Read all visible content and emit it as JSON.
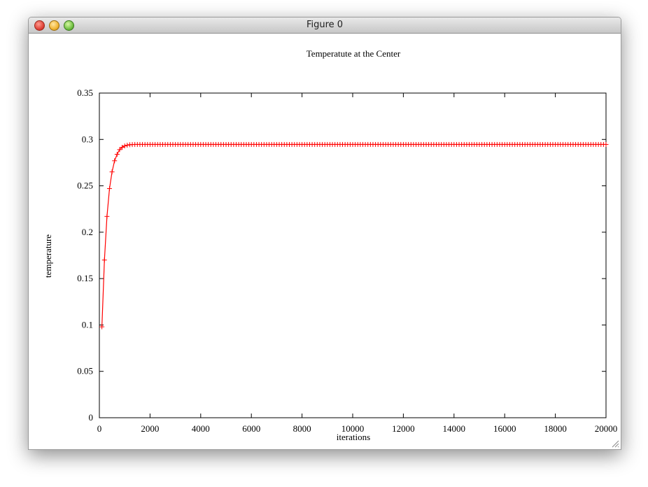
{
  "window": {
    "title": "Figure 0",
    "controls": [
      "close-button",
      "minimize-button",
      "zoom-button"
    ]
  },
  "chart_data": {
    "type": "line",
    "title": "Temperatute at the Center",
    "xlabel": "iterations",
    "ylabel": "temperature",
    "xlim": [
      0,
      20000
    ],
    "ylim": [
      0,
      0.35
    ],
    "x_ticks": [
      0,
      2000,
      4000,
      6000,
      8000,
      10000,
      12000,
      14000,
      16000,
      18000,
      20000
    ],
    "x_tick_labels": [
      "0",
      "2000",
      "4000",
      "6000",
      "8000",
      "10000",
      "12000",
      "14000",
      "16000",
      "18000",
      "20000"
    ],
    "y_ticks": [
      0,
      0.05,
      0.1,
      0.15,
      0.2,
      0.25,
      0.3,
      0.35
    ],
    "y_tick_labels": [
      "0",
      "0.05",
      "0.1",
      "0.15",
      "0.2",
      "0.25",
      "0.3",
      "0.35"
    ],
    "grid": false,
    "series": [
      {
        "color": "#ff0000",
        "marker": "+",
        "x": [
          100,
          200,
          300,
          400,
          500,
          600,
          700,
          800,
          900,
          1000,
          1100,
          1200,
          1300,
          1400,
          1500,
          1600,
          1700,
          1800,
          1900,
          2000,
          2100,
          2200,
          2300,
          2400,
          2500,
          2600,
          2700,
          2800,
          2900,
          3000,
          3100,
          3200,
          3300,
          3400,
          3500,
          3600,
          3700,
          3800,
          3900,
          4000,
          4100,
          4200,
          4300,
          4400,
          4500,
          4600,
          4700,
          4800,
          4900,
          5000,
          5100,
          5200,
          5300,
          5400,
          5500,
          5600,
          5700,
          5800,
          5900,
          6000,
          6100,
          6200,
          6300,
          6400,
          6500,
          6600,
          6700,
          6800,
          6900,
          7000,
          7100,
          7200,
          7300,
          7400,
          7500,
          7600,
          7700,
          7800,
          7900,
          8000,
          8100,
          8200,
          8300,
          8400,
          8500,
          8600,
          8700,
          8800,
          8900,
          9000,
          9100,
          9200,
          9300,
          9400,
          9500,
          9600,
          9700,
          9800,
          9900,
          10000,
          10100,
          10200,
          10300,
          10400,
          10500,
          10600,
          10700,
          10800,
          10900,
          11000,
          11100,
          11200,
          11300,
          11400,
          11500,
          11600,
          11700,
          11800,
          11900,
          12000,
          12100,
          12200,
          12300,
          12400,
          12500,
          12600,
          12700,
          12800,
          12900,
          13000,
          13100,
          13200,
          13300,
          13400,
          13500,
          13600,
          13700,
          13800,
          13900,
          14000,
          14100,
          14200,
          14300,
          14400,
          14500,
          14600,
          14700,
          14800,
          14900,
          15000,
          15100,
          15200,
          15300,
          15400,
          15500,
          15600,
          15700,
          15800,
          15900,
          16000,
          16100,
          16200,
          16300,
          16400,
          16500,
          16600,
          16700,
          16800,
          16900,
          17000,
          17100,
          17200,
          17300,
          17400,
          17500,
          17600,
          17700,
          17800,
          17900,
          18000,
          18100,
          18200,
          18300,
          18400,
          18500,
          18600,
          18700,
          18800,
          18900,
          19000,
          19100,
          19200,
          19300,
          19400,
          19500,
          19600,
          19700,
          19800,
          19900,
          20000
        ],
        "y": [
          0.098,
          0.17,
          0.217,
          0.247,
          0.265,
          0.277,
          0.284,
          0.289,
          0.2915,
          0.293,
          0.2938,
          0.2943,
          0.2945,
          0.2946,
          0.2946,
          0.2946,
          0.2946,
          0.2946,
          0.2946,
          0.2946,
          0.2946,
          0.2946,
          0.2946,
          0.2946,
          0.2946,
          0.2946,
          0.2946,
          0.2946,
          0.2946,
          0.2946,
          0.2946,
          0.2946,
          0.2946,
          0.2946,
          0.2946,
          0.2946,
          0.2946,
          0.2946,
          0.2946,
          0.2946,
          0.2946,
          0.2946,
          0.2946,
          0.2946,
          0.2946,
          0.2946,
          0.2946,
          0.2946,
          0.2946,
          0.2946,
          0.2946,
          0.2946,
          0.2946,
          0.2946,
          0.2946,
          0.2946,
          0.2946,
          0.2946,
          0.2946,
          0.2946,
          0.2946,
          0.2946,
          0.2946,
          0.2946,
          0.2946,
          0.2946,
          0.2946,
          0.2946,
          0.2946,
          0.2946,
          0.2946,
          0.2946,
          0.2946,
          0.2946,
          0.2946,
          0.2946,
          0.2946,
          0.2946,
          0.2946,
          0.2946,
          0.2946,
          0.2946,
          0.2946,
          0.2946,
          0.2946,
          0.2946,
          0.2946,
          0.2946,
          0.2946,
          0.2946,
          0.2946,
          0.2946,
          0.2946,
          0.2946,
          0.2946,
          0.2946,
          0.2946,
          0.2946,
          0.2946,
          0.2946,
          0.2946,
          0.2946,
          0.2946,
          0.2946,
          0.2946,
          0.2946,
          0.2946,
          0.2946,
          0.2946,
          0.2946,
          0.2946,
          0.2946,
          0.2946,
          0.2946,
          0.2946,
          0.2946,
          0.2946,
          0.2946,
          0.2946,
          0.2946,
          0.2946,
          0.2946,
          0.2946,
          0.2946,
          0.2946,
          0.2946,
          0.2946,
          0.2946,
          0.2946,
          0.2946,
          0.2946,
          0.2946,
          0.2946,
          0.2946,
          0.2946,
          0.2946,
          0.2946,
          0.2946,
          0.2946,
          0.2946,
          0.2946,
          0.2946,
          0.2946,
          0.2946,
          0.2946,
          0.2946,
          0.2946,
          0.2946,
          0.2946,
          0.2946,
          0.2946,
          0.2946,
          0.2946,
          0.2946,
          0.2946,
          0.2946,
          0.2946,
          0.2946,
          0.2946,
          0.2946,
          0.2946,
          0.2946,
          0.2946,
          0.2946,
          0.2946,
          0.2946,
          0.2946,
          0.2946,
          0.2946,
          0.2946,
          0.2946,
          0.2946,
          0.2946,
          0.2946,
          0.2946,
          0.2946,
          0.2946,
          0.2946,
          0.2946,
          0.2946,
          0.2946,
          0.2946,
          0.2946,
          0.2946,
          0.2946,
          0.2946,
          0.2946,
          0.2946,
          0.2946,
          0.2946,
          0.2946,
          0.2946,
          0.2946,
          0.2946,
          0.2946,
          0.2946,
          0.2946,
          0.2946,
          0.2946,
          0.2946
        ]
      }
    ]
  }
}
